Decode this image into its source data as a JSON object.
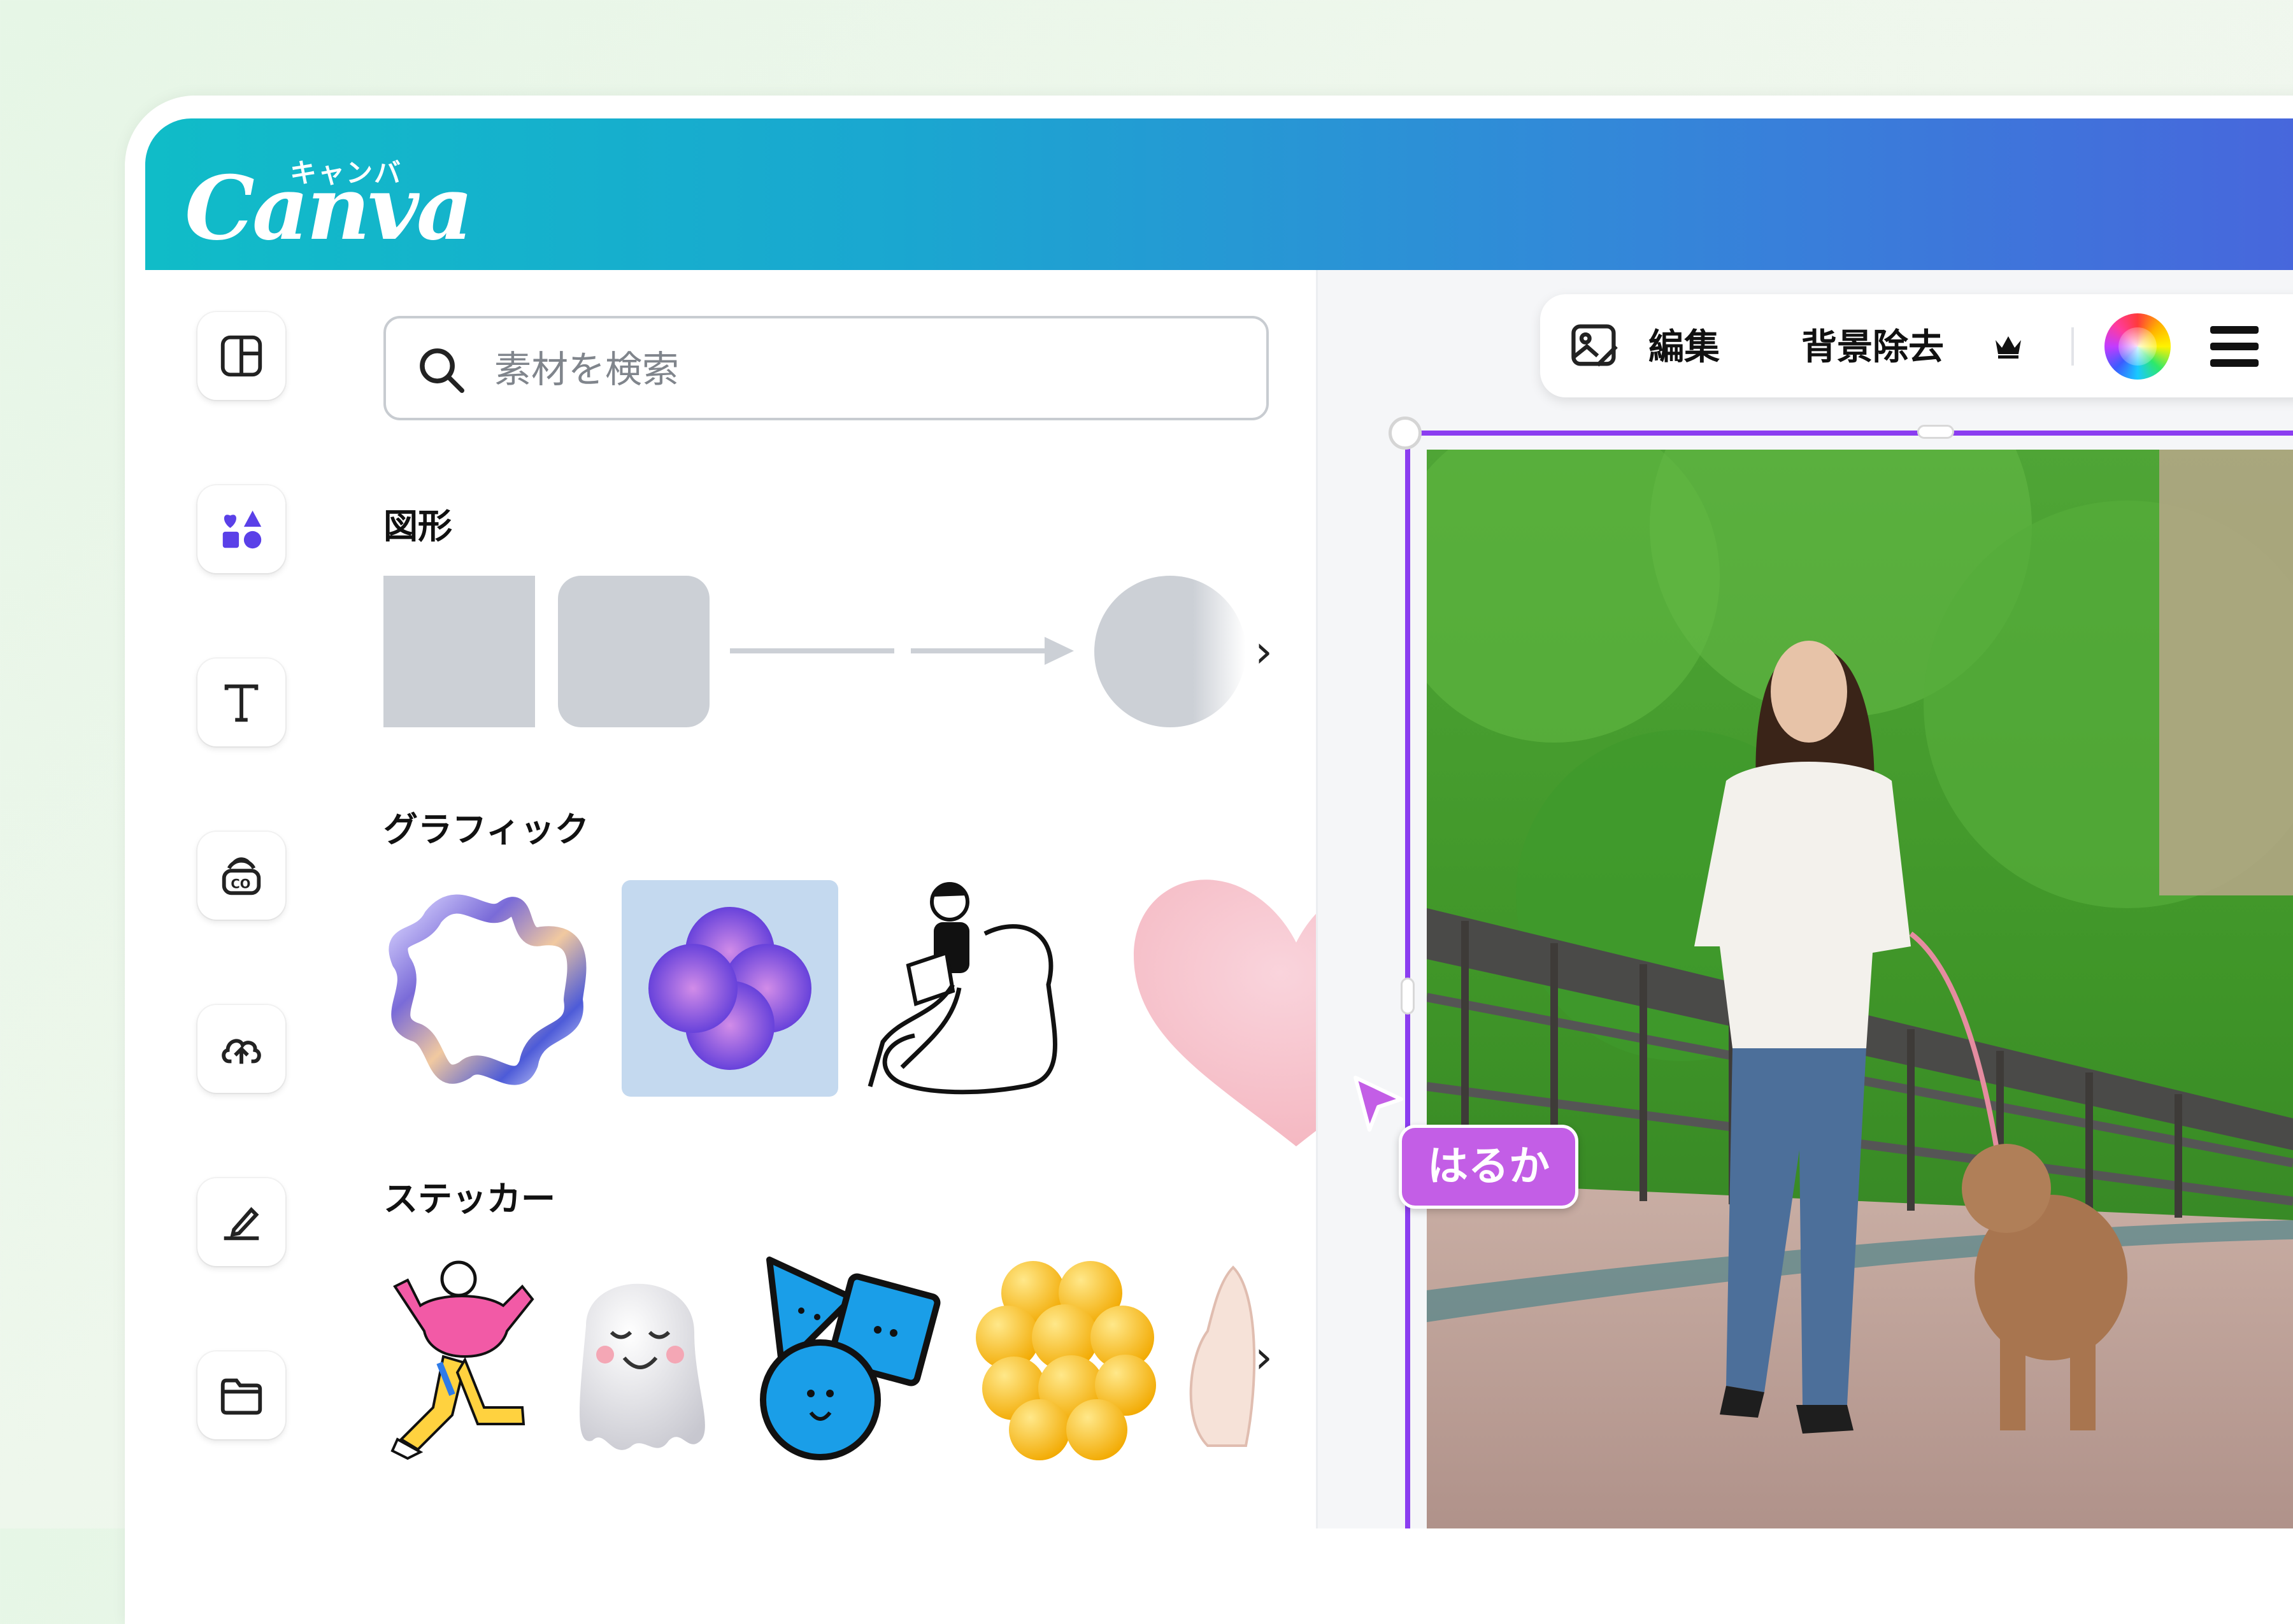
{
  "app": {
    "logo_text": "Canva",
    "logo_kana": "キャンバ"
  },
  "search": {
    "placeholder": "素材を検索"
  },
  "sections": {
    "shapes": {
      "title": "図形"
    },
    "graphics": {
      "title": "グラフィック"
    },
    "stickers": {
      "title": "ステッカー"
    }
  },
  "toolbar": {
    "edit_label": "編集",
    "bg_remove_label": "背景除去"
  },
  "collaborator": {
    "name": "はるか"
  },
  "colors": {
    "accent_purple": "#8b3df0",
    "collab_tag": "#c35ee6",
    "brand_teal": "#10bcc8",
    "brand_blue": "#4767dc"
  },
  "icons": {
    "rail": [
      "layout-icon",
      "elements-icon",
      "text-icon",
      "brand-icon",
      "upload-icon",
      "draw-icon",
      "folder-icon"
    ],
    "toolbar": [
      "image-edit-icon",
      "crown-icon",
      "color-wheel-icon",
      "menu-icon"
    ]
  }
}
